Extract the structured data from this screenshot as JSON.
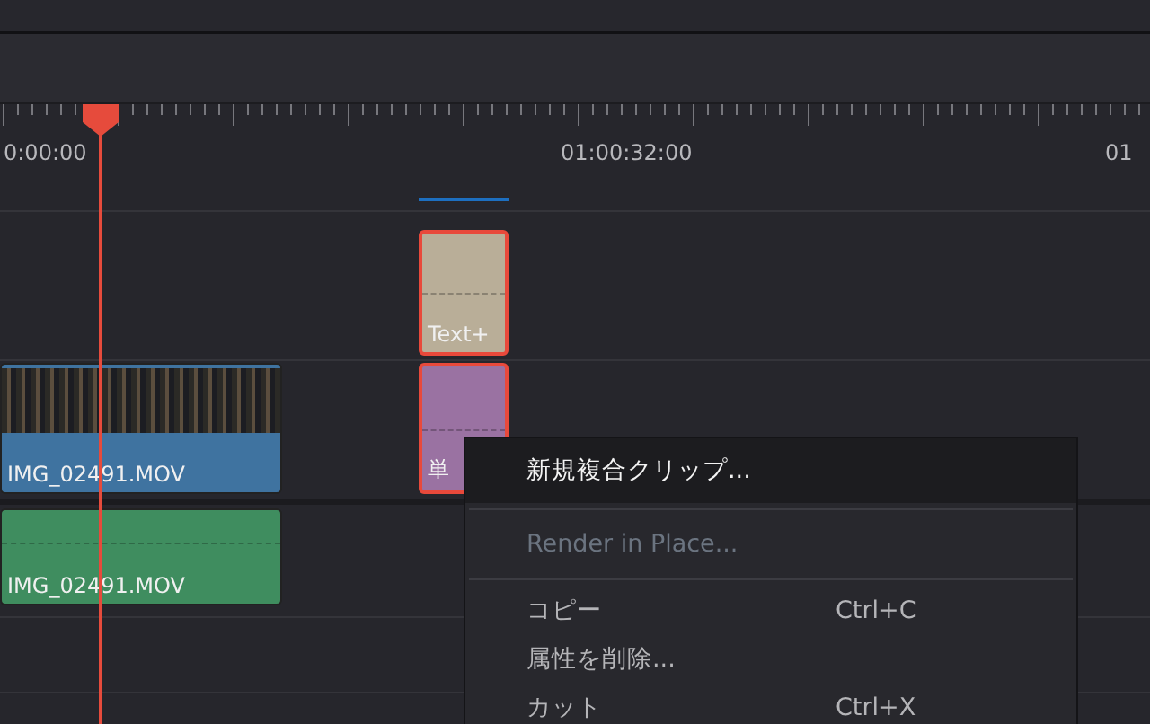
{
  "ruler": {
    "timecodes": [
      {
        "label": "0:00:00"
      },
      {
        "label": "01:00:32:00"
      },
      {
        "label": "01"
      }
    ]
  },
  "clips": [
    {
      "kind": "title",
      "label": "Text+",
      "selected": true
    },
    {
      "kind": "video",
      "label": "IMG_02491.MOV",
      "selected": false
    },
    {
      "kind": "solid",
      "label": "単",
      "selected": true
    },
    {
      "kind": "audio",
      "label": "IMG_02491.MOV",
      "selected": false
    }
  ],
  "context_menu": {
    "items": [
      {
        "kind": "item",
        "label": "新規複合クリップ...",
        "disabled": false,
        "selected": true
      },
      {
        "kind": "separator"
      },
      {
        "kind": "item",
        "label": "Render in Place...",
        "disabled": true,
        "selected": false
      },
      {
        "kind": "separator"
      },
      {
        "kind": "item",
        "label": "コピー",
        "shortcut": "Ctrl+C",
        "disabled": false,
        "selected": false
      },
      {
        "kind": "item",
        "label": "属性を削除...",
        "disabled": false,
        "selected": false
      },
      {
        "kind": "item",
        "label": "カット",
        "shortcut": "Ctrl+X",
        "disabled": false,
        "selected": false
      }
    ]
  }
}
